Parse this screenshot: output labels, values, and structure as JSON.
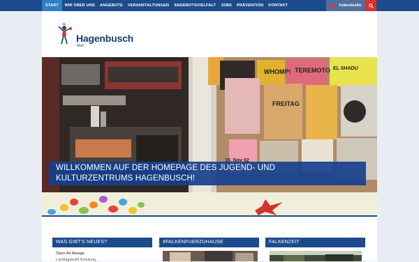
{
  "nav": {
    "items": [
      {
        "label": "START",
        "active": true
      },
      {
        "label": "WIR ÜBER UNS"
      },
      {
        "label": "ANGEBOTE"
      },
      {
        "label": "VERANSTALTUNGEN"
      },
      {
        "label": "ANGEBOTSVIELFALT"
      },
      {
        "label": "JOBS"
      },
      {
        "label": "PRÄVENTION"
      },
      {
        "label": "KONTAKT"
      }
    ],
    "falken_label": "Falkenfarnilie",
    "search_icon": "search-icon"
  },
  "logo": {
    "title": "Hagenbusch",
    "subtitle": "Marl"
  },
  "hero": {
    "banner_line1": "WILLKOMMEN AUF DER HOMEPAGE DES JUGEND- UND",
    "banner_line2": "KULTURZENTRUMS HAGENBUSCH!"
  },
  "columns": {
    "news": {
      "title": "WAS GIBT'S NEUES?",
      "items": [
        "Open-Air Absage",
        "Landtagswahl Schulung..."
      ]
    },
    "falken_home": {
      "title": "#FALKENFUERZUHAUSE"
    },
    "falkenzeit": {
      "title": "FALKENZEIT"
    }
  },
  "colors": {
    "nav": "#1c4b8d",
    "active": "#2f7fc7",
    "accent": "#d6332c",
    "page_bg": "#e9edf3"
  }
}
